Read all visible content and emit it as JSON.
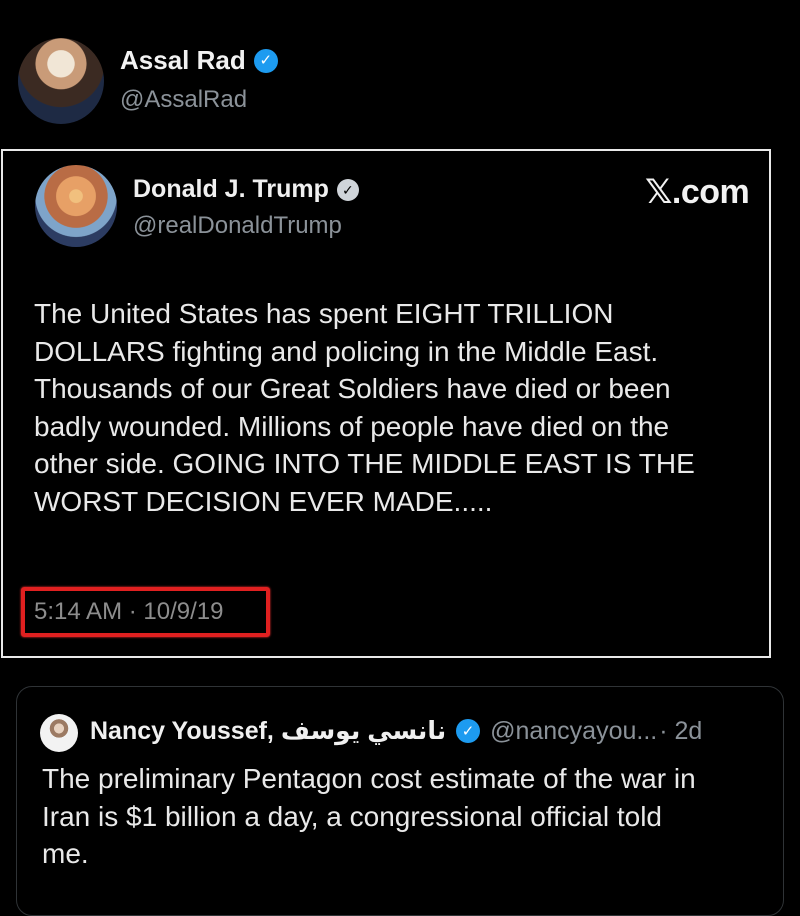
{
  "top_author": {
    "name": "Assal Rad",
    "handle": "@AssalRad",
    "verified_icon": "verified-badge-blue"
  },
  "embedded_tweet": {
    "name": "Donald J. Trump",
    "handle": "@realDonaldTrump",
    "verified_icon": "verified-badge-gray",
    "source": "𝕏.com",
    "text_lines": [
      "The United States has spent EIGHT TRILLION",
      "DOLLARS fighting and policing in the Middle East.",
      "Thousands of our Great Soldiers have died or been",
      "badly wounded. Millions of people have died on the",
      "other side. GOING INTO THE MIDDLE EAST IS THE",
      "WORST DECISION EVER MADE....."
    ],
    "timestamp": "5:14 AM · 10/9/19",
    "highlight_color": "#e02020"
  },
  "quoted_tweet": {
    "name": "Nancy Youssef, نانسي يوسف",
    "handle": "@nancyayou...",
    "age": "· 2d",
    "verified_icon": "verified-badge-blue",
    "text_lines": [
      "The preliminary Pentagon cost estimate of the war in",
      "Iran is $1 billion a day, a congressional official told",
      "me."
    ]
  },
  "colors": {
    "background": "#000000",
    "text": "#e7e9ea",
    "secondary_text": "#8b9299",
    "verified_blue": "#1d9bf0"
  }
}
